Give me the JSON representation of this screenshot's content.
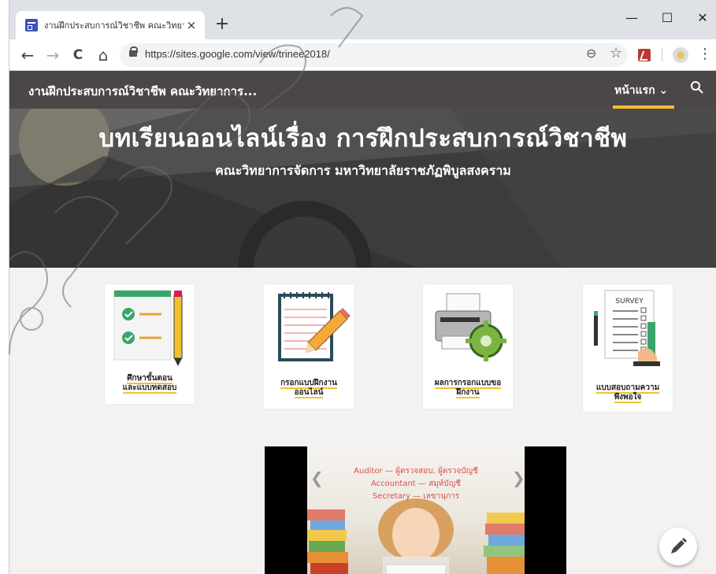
{
  "browser": {
    "tab_title": "งานฝึกประสบการณ์วิชาชีพ คณะวิทยาก",
    "tab_close": "×",
    "new_tab": "+",
    "url": "https://sites.google.com/view/trinee2018/",
    "window_controls": {
      "minimize": "—",
      "maximize": "☐",
      "close": "✕"
    },
    "nav": {
      "back": "←",
      "forward": "→",
      "reload": "C",
      "home": "⌂"
    },
    "icons": [
      "lock-icon",
      "zoom-icon",
      "star-icon",
      "pdf-extension-icon",
      "flower-extension-icon",
      "menu-icon"
    ]
  },
  "site": {
    "title": "งานฝึกประสบการณ์วิชาชีพ คณะวิทยาการ...",
    "nav_home": "หน้าแรก ⌄",
    "accent": "#f2c12e",
    "header_bg": "#4b4648"
  },
  "hero": {
    "title": "บทเรียนออนไลน์เรื่อง การฝึกประสบการณ์วิชาชีพ",
    "subtitle": "คณะวิทยาการจัดการ มหาวิทยาลัยราชภัฏพิบูลสงคราม"
  },
  "cards": [
    {
      "line1": "ศึกษาขั้นตอน",
      "line2": "และแบบทดสอบ",
      "icon": "checklist-pencil-icon"
    },
    {
      "line1": "กรอกแบบฝึกงาน",
      "line2": "ออนไลน์",
      "icon": "notepad-pencil-icon"
    },
    {
      "line1": "ผลการกรอกแบบขอ",
      "line2": "ฝึกงาน",
      "icon": "printer-gear-icon"
    },
    {
      "line1": "แบบสอบถามความ",
      "line2": "พึงพอใจ",
      "icon": "survey-icon"
    }
  ],
  "survey_heading": "SURVEY",
  "slideshow": {
    "lines": [
      "Auditor — ผู้ตรวจสอบ, ผู้ตรวจบัญชี",
      "Accountant — สมุห์บัญชี",
      "Secretary — เลขานุการ"
    ],
    "prev": "❮",
    "next": "❯"
  },
  "fab_icon": "edit-pencil-icon"
}
